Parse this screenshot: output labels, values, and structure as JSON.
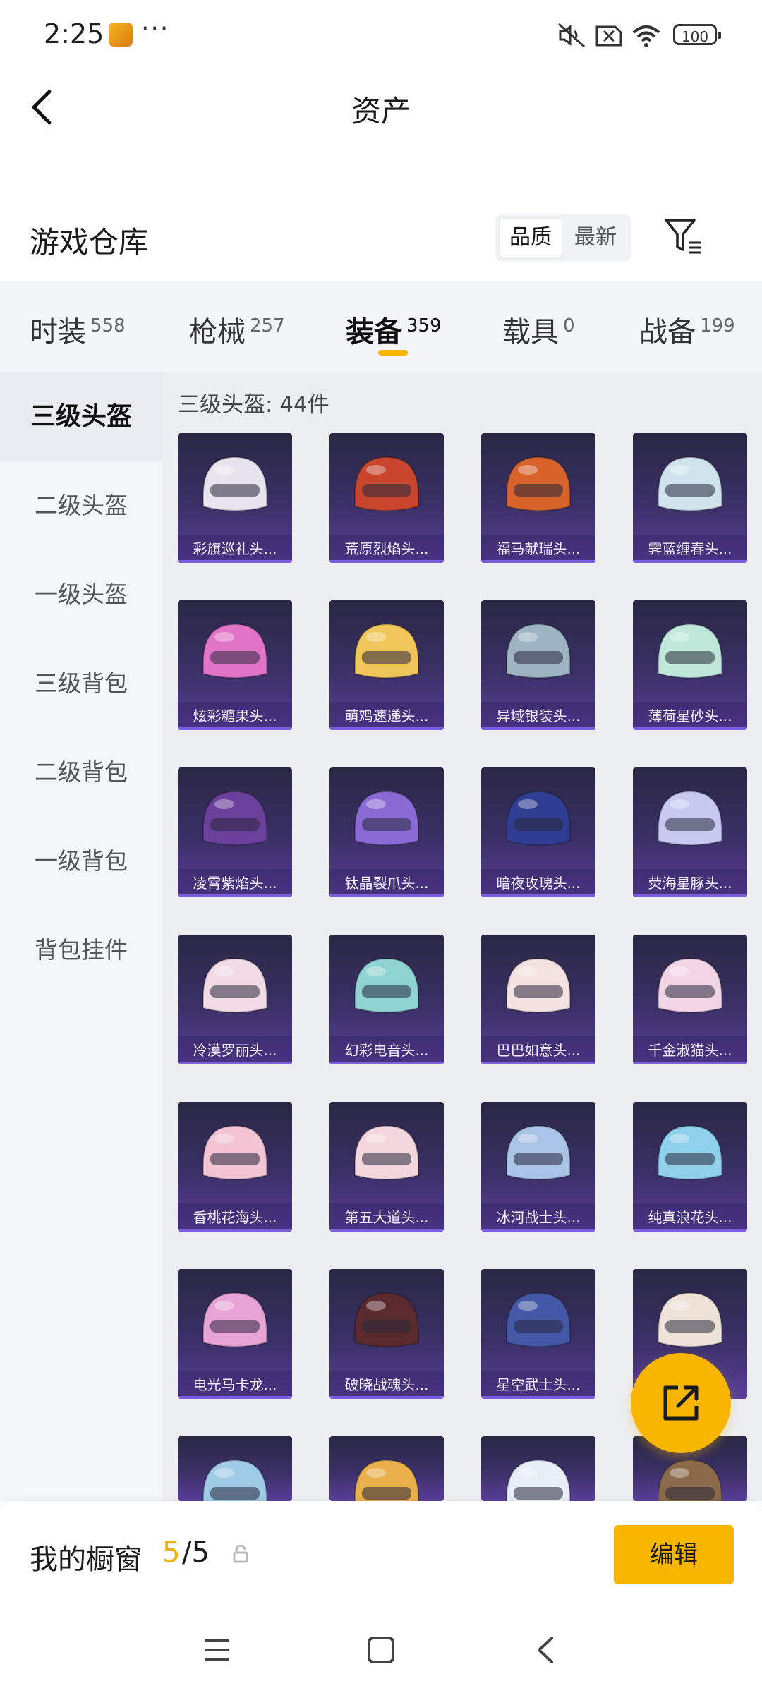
{
  "status_bar": {
    "time": "2:25",
    "more": "···",
    "battery": "100"
  },
  "header": {
    "title": "资产"
  },
  "warehouse": {
    "title": "游戏仓库",
    "sort_options": [
      "品质",
      "最新"
    ],
    "active_sort": "品质"
  },
  "tabs": [
    {
      "label": "时装",
      "count": "558"
    },
    {
      "label": "枪械",
      "count": "257"
    },
    {
      "label": "装备",
      "count": "359",
      "active": true
    },
    {
      "label": "载具",
      "count": "0"
    },
    {
      "label": "战备",
      "count": "199"
    }
  ],
  "categories": [
    "三级头盔",
    "二级头盔",
    "一级头盔",
    "三级背包",
    "二级背包",
    "一级背包",
    "背包挂件"
  ],
  "active_category": "三级头盔",
  "content": {
    "count_label": "三级头盔: 44件",
    "items": [
      {
        "name": "彩旗巡礼头...",
        "color": "#e8e4ef"
      },
      {
        "name": "荒原烈焰头...",
        "color": "#c7462d"
      },
      {
        "name": "福马献瑞头...",
        "color": "#d7632a"
      },
      {
        "name": "霁蓝缠春头...",
        "color": "#cfe3ec"
      },
      {
        "name": "炫彩糖果头...",
        "color": "#e274c7"
      },
      {
        "name": "萌鸡速递头...",
        "color": "#f0c65a"
      },
      {
        "name": "异域银装头...",
        "color": "#9fb4c2"
      },
      {
        "name": "薄荷星砂头...",
        "color": "#bfe8da"
      },
      {
        "name": "凌霄紫焰头...",
        "color": "#6b3f9c"
      },
      {
        "name": "钛晶裂爪头...",
        "color": "#8b6ad6"
      },
      {
        "name": "暗夜玫瑰头...",
        "color": "#2f3e93"
      },
      {
        "name": "荧海星豚头...",
        "color": "#c8c9f0"
      },
      {
        "name": "冷漠罗丽头...",
        "color": "#f1dbe5"
      },
      {
        "name": "幻彩电音头...",
        "color": "#8fd4d0"
      },
      {
        "name": "巴巴如意头...",
        "color": "#f4e1e1"
      },
      {
        "name": "千金淑猫头...",
        "color": "#f3d6e6"
      },
      {
        "name": "香桃花海头...",
        "color": "#f2c4d4"
      },
      {
        "name": "第五大道头...",
        "color": "#f4d7dd"
      },
      {
        "name": "冰河战士头...",
        "color": "#a9c4e6"
      },
      {
        "name": "纯真浪花头...",
        "color": "#8fd0ea"
      },
      {
        "name": "电光马卡龙...",
        "color": "#e7a3d6"
      },
      {
        "name": "破晓战魂头...",
        "color": "#5a2a2e"
      },
      {
        "name": "星空武士头...",
        "color": "#4458a8"
      },
      {
        "name": "",
        "color": "#efe2d9"
      },
      {
        "name": "",
        "color": "#9fcbe6"
      },
      {
        "name": "",
        "color": "#e9b04b"
      },
      {
        "name": "",
        "color": "#e7eef7"
      },
      {
        "name": "",
        "color": "#8a6a4a"
      }
    ]
  },
  "showcase": {
    "label": "我的橱窗",
    "used": "5",
    "total": "/5",
    "edit_label": "编辑"
  },
  "colors": {
    "accent": "#f7b500",
    "card_bg": "#3a3066"
  }
}
